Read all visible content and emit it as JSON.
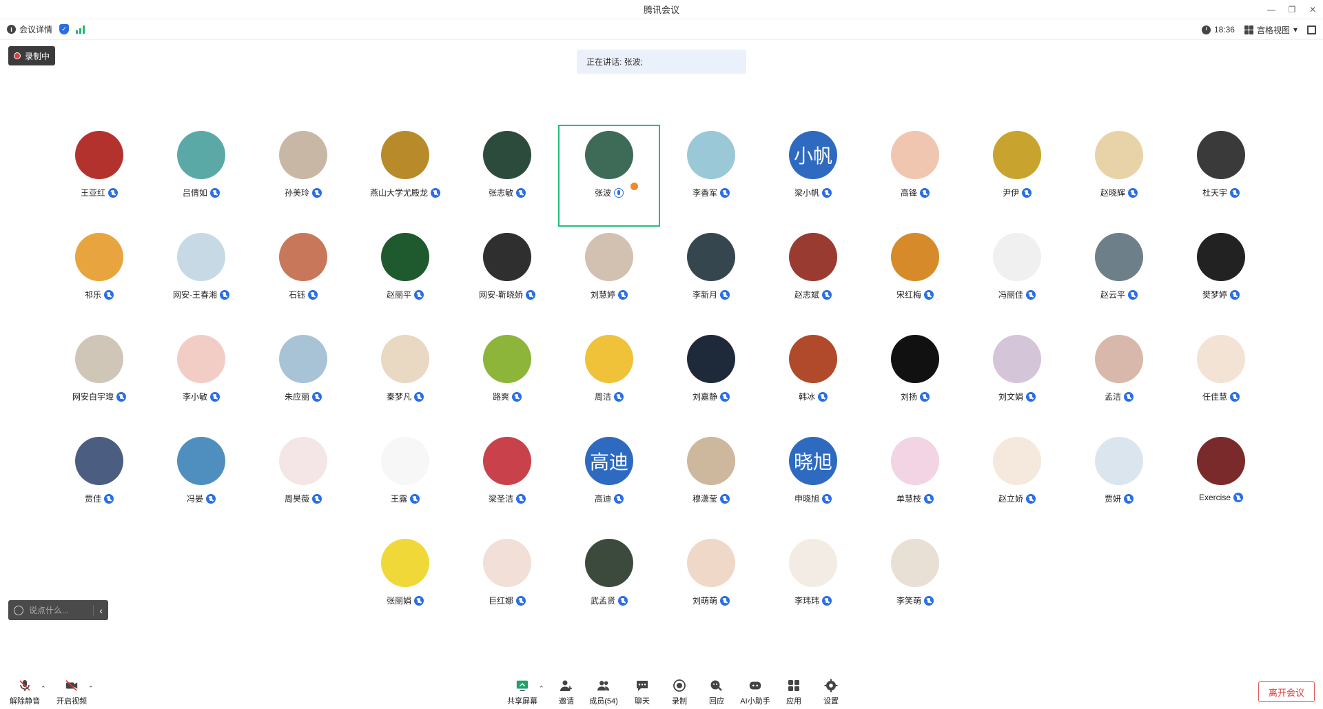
{
  "app": {
    "title": "腾讯会议"
  },
  "window_controls": {
    "minimize": "—",
    "restore": "❐",
    "close": "✕"
  },
  "infobar": {
    "meeting_details": "会议详情",
    "time": "18:36",
    "view_mode": "宫格视图",
    "view_caret": "▾"
  },
  "recording": {
    "label": "录制中"
  },
  "speaking": {
    "text": "正在讲话: 张波;"
  },
  "participants": [
    {
      "name": "王亚红",
      "color": "#b4322e"
    },
    {
      "name": "吕倩如",
      "color": "#5aa9a6"
    },
    {
      "name": "孙美玲",
      "color": "#c9b7a6"
    },
    {
      "name": "燕山大学尤殿龙",
      "color": "#b98a2a"
    },
    {
      "name": "张志敏",
      "color": "#2d4b3c"
    },
    {
      "name": "张波",
      "color": "#3e6b57",
      "active": true,
      "mic_on": true
    },
    {
      "name": "李香军",
      "color": "#9bc8d6"
    },
    {
      "name": "梁小帆",
      "color": "#2d6ac0",
      "text": "小帆"
    },
    {
      "name": "高锋",
      "color": "#f0c6b0"
    },
    {
      "name": "尹伊",
      "color": "#c8a42f"
    },
    {
      "name": "赵晓辉",
      "color": "#e8d2a8"
    },
    {
      "name": "杜天宇",
      "color": "#3a3a3a"
    },
    {
      "name": "祁乐",
      "color": "#e8a43e"
    },
    {
      "name": "网安-王春湘",
      "color": "#c7d9e4"
    },
    {
      "name": "石钰",
      "color": "#c8775b"
    },
    {
      "name": "赵丽平",
      "color": "#1f5a2e"
    },
    {
      "name": "网安-靳晓娇",
      "color": "#2f2f2f"
    },
    {
      "name": "刘慧婷",
      "color": "#d2c0b0"
    },
    {
      "name": "李新月",
      "color": "#36464e"
    },
    {
      "name": "赵志斌",
      "color": "#9a3b32"
    },
    {
      "name": "宋红梅",
      "color": "#d68a2a"
    },
    {
      "name": "冯丽佳",
      "color": "#f0f0f0"
    },
    {
      "name": "赵云平",
      "color": "#6d7f89"
    },
    {
      "name": "樊梦婷",
      "color": "#222222"
    },
    {
      "name": "网安白宇瑋",
      "color": "#cfc6b8"
    },
    {
      "name": "李小敏",
      "color": "#f2cdc6"
    },
    {
      "name": "朱应丽",
      "color": "#a8c3d6"
    },
    {
      "name": "秦梦凡",
      "color": "#e9d8c2"
    },
    {
      "name": "路爽",
      "color": "#8db53a"
    },
    {
      "name": "周洁",
      "color": "#f0c23a"
    },
    {
      "name": "刘嘉静",
      "color": "#1e2a3a"
    },
    {
      "name": "韩冰",
      "color": "#b04a2a"
    },
    {
      "name": "刘扬",
      "color": "#111111"
    },
    {
      "name": "刘文娟",
      "color": "#d5c5d8"
    },
    {
      "name": "孟洁",
      "color": "#d8b8aa"
    },
    {
      "name": "任佳慧",
      "color": "#f3e3d5"
    },
    {
      "name": "贾佳",
      "color": "#4b5d80"
    },
    {
      "name": "冯晏",
      "color": "#4f8fc0"
    },
    {
      "name": "周昊薇",
      "color": "#f4e6e6"
    },
    {
      "name": "王露",
      "color": "#f7f7f7"
    },
    {
      "name": "梁圣洁",
      "color": "#c9414a"
    },
    {
      "name": "高迪",
      "color": "#2d6ac0",
      "text": "高迪"
    },
    {
      "name": "穆潇莹",
      "color": "#cdb79d"
    },
    {
      "name": "申晓旭",
      "color": "#2d6ac0",
      "text": "晓旭"
    },
    {
      "name": "单慧枝",
      "color": "#f2d4e4"
    },
    {
      "name": "赵立娇",
      "color": "#f4e9dc"
    },
    {
      "name": "贾妍",
      "color": "#dbe5ee"
    },
    {
      "name": "Exercise",
      "color": "#7a2a2a"
    },
    {
      "name": "张丽娟",
      "color": "#f0d838"
    },
    {
      "name": "巨红娜",
      "color": "#f2e0d8"
    },
    {
      "name": "武孟贤",
      "color": "#3c4a3e"
    },
    {
      "name": "刘萌萌",
      "color": "#f0d8c8"
    },
    {
      "name": "李玮玮",
      "color": "#f2ece4"
    },
    {
      "name": "李笑萌",
      "color": "#e8e0d4"
    }
  ],
  "chat": {
    "placeholder": "说点什么...",
    "collapse": "‹"
  },
  "toolbar": {
    "unmute": "解除静音",
    "start_video": "开启视频",
    "share_screen": "共享屏幕",
    "invite": "邀请",
    "members": "成员(54)",
    "chat": "聊天",
    "record": "录制",
    "reactions": "回应",
    "ai_assistant": "AI小助手",
    "apps": "应用",
    "settings": "设置",
    "leave": "离开会议",
    "caret": "⌃"
  }
}
